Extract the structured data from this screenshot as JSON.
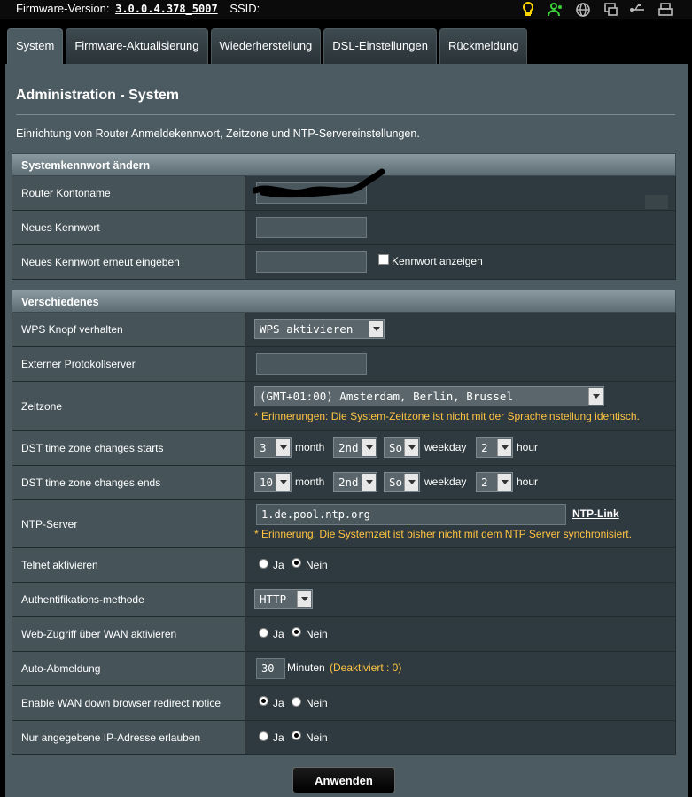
{
  "header": {
    "firmware_label": "Firmware-Version:",
    "firmware_value": "3.0.0.4.378_5007",
    "ssid_label": "SSID:",
    "status_icons": [
      "lightbulb-icon",
      "users-icon",
      "globe-icon",
      "devices-icon",
      "usb-icon",
      "printer-icon"
    ]
  },
  "tabs": [
    {
      "label": "System",
      "active": true
    },
    {
      "label": "Firmware-Aktualisierung"
    },
    {
      "label": "Wiederherstellung"
    },
    {
      "label": "DSL-Einstellungen"
    },
    {
      "label": "Rückmeldung"
    }
  ],
  "page": {
    "title": "Administration - System",
    "description": "Einrichtung von Router Anmeldekennwort, Zeitzone und NTP-Servereinstellungen."
  },
  "password_section": {
    "title": "Systemkennwort ändern",
    "account_name_label": "Router Kontoname",
    "new_password_label": "Neues Kennwort",
    "confirm_password_label": "Neues Kennwort erneut eingeben",
    "show_password_label": "Kennwort anzeigen"
  },
  "misc_section": {
    "title": "Verschiedenes",
    "wps_label": "WPS Knopf verhalten",
    "wps_value": "WPS aktivieren",
    "syslog_label": "Externer Protokollserver",
    "timezone_label": "Zeitzone",
    "timezone_value": "(GMT+01:00) Amsterdam, Berlin, Brussel",
    "timezone_note": "* Erinnerungen: Die System-Zeitzone ist nicht mit der Spracheinstellung identisch.",
    "dst_start_label": "DST time zone changes starts",
    "dst_start": {
      "month": "3",
      "week": "2nd",
      "day": "So",
      "hour": "2"
    },
    "dst_end_label": "DST time zone changes ends",
    "dst_end": {
      "month": "10",
      "week": "2nd",
      "day": "So",
      "hour": "2"
    },
    "month_unit": "month",
    "weekday_unit": "weekday",
    "hour_unit": "hour",
    "ntp_label": "NTP-Server",
    "ntp_value": "1.de.pool.ntp.org",
    "ntp_link": "NTP-Link",
    "ntp_note": "* Erinnerung: Die Systemzeit ist bisher nicht mit dem NTP Server synchronisiert.",
    "telnet_label": "Telnet aktivieren",
    "auth_label": "Authentifikations-methode",
    "auth_value": "HTTP",
    "web_wan_label": "Web-Zugriff über WAN aktivieren",
    "auto_logout_label": "Auto-Abmeldung",
    "auto_logout_value": "30",
    "auto_logout_unit": "Minuten",
    "auto_logout_note": "(Deaktiviert : 0)",
    "wan_notice_label": "Enable WAN down browser redirect notice",
    "ip_only_label": "Nur angegebene IP-Adresse erlauben",
    "yes": "Ja",
    "no": "Nein"
  },
  "apply_button": "Anwenden"
}
